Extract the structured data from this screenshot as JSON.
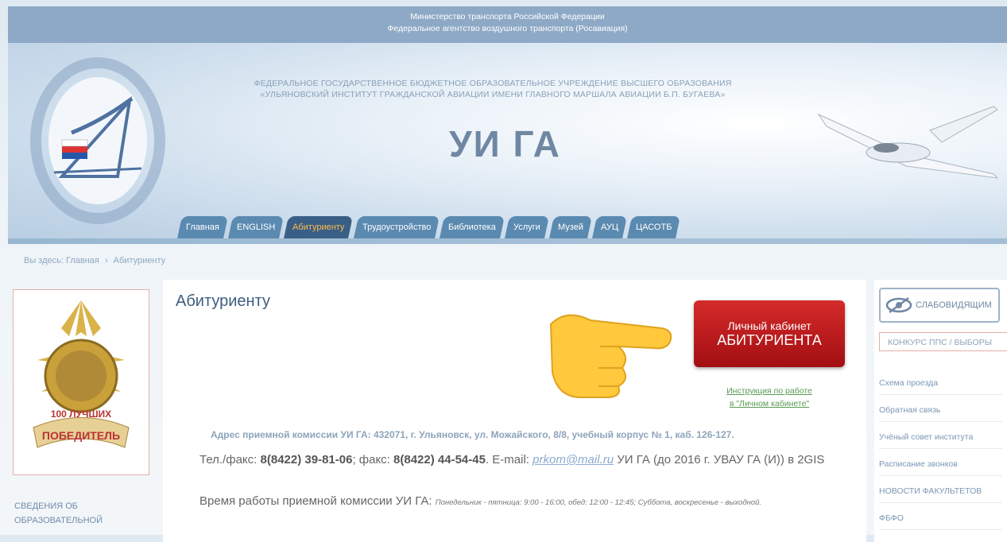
{
  "top": {
    "line1": "Министерство транспорта Российской Федерации",
    "line2": "Федеральное агентство воздушного транспорта (Росавиация)"
  },
  "header": {
    "inst_line1": "ФЕДЕРАЛЬНОЕ ГОСУДАРСТВЕННОЕ БЮДЖЕТНОЕ ОБРАЗОВАТЕЛЬНОЕ УЧРЕЖДЕНИЕ ВЫСШЕГО ОБРАЗОВАНИЯ",
    "inst_line2": "«УЛЬЯНОВСКИЙ ИНСТИТУТ ГРАЖДАНСКОЙ АВИАЦИИ ИМЕНИ ГЛАВНОГО МАРШАЛА АВИАЦИИ Б.П. БУГАЕВА»",
    "abbr": "УИ ГА"
  },
  "nav": [
    "Главная",
    "ENGLISH",
    "Абитуриенту",
    "Трудоустройство",
    "Библиотека",
    "Услуги",
    "Музей",
    "АУЦ",
    "ЦАСОТБ"
  ],
  "breadcrumb": {
    "prefix": "Вы здесь:",
    "home": "Главная",
    "current": "Абитуриенту"
  },
  "left": {
    "medal_text1": "100 ЛУЧШИХ",
    "medal_text2": "ПОБЕДИТЕЛЬ",
    "link_line1": "СВЕДЕНИЯ ОБ",
    "link_line2": "ОБРАЗОВАТЕЛЬНОЙ"
  },
  "main": {
    "title": "Абитуриенту",
    "cabinet_line1": "Личный кабинет",
    "cabinet_line2": "АБИТУРИЕНТА",
    "instr_line1": "Инструкция по работе",
    "instr_line2": "в \"Личном кабинете\"",
    "address": "Адрес приемной комиссии УИ ГА:  432071, г. Ульяновск, ул. Можайского, 8/8, учебный корпус № 1, каб. 126-127.",
    "tel_label": "Тел./факс: ",
    "tel": "8(8422) 39-81-06",
    "fax_label": "; факс: ",
    "fax": "8(8422) 44-54-45",
    "email_label": ". E-mail: ",
    "email": "prkom@mail.ru",
    "tel_suffix": "   УИ ГА (до 2016 г. УВАУ ГА (И)) в 2GIS",
    "work_label": "Время работы приемной комиссии УИ ГА:  ",
    "work_hours": "Понедельник - пятница: 9:00 - 16:00,  обед: 12:00 - 12:45;  Суббота, воскресенье - выходной."
  },
  "right": {
    "low_vision": "СЛАБОВИДЯЩИМ",
    "contest": "КОНКУРС ППС / ВЫБОРЫ",
    "links": [
      "Схема проезда",
      "Обратная связь",
      "Учёный совет института",
      "Расписание звонков",
      "НОВОСТИ ФАКУЛЬТЕТОВ",
      "ФБФО"
    ]
  }
}
